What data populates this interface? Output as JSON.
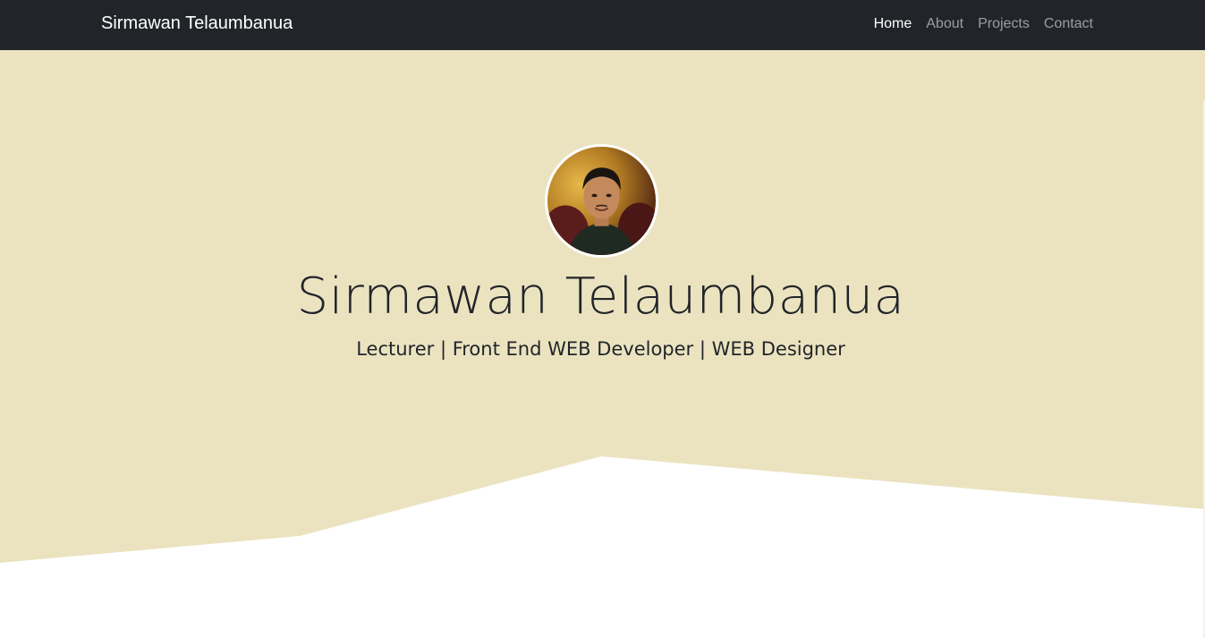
{
  "navbar": {
    "brand": "Sirmawan Telaumbanua",
    "links": [
      {
        "label": "Home",
        "active": true
      },
      {
        "label": "About",
        "active": false
      },
      {
        "label": "Projects",
        "active": false
      },
      {
        "label": "Contact",
        "active": false
      }
    ]
  },
  "hero": {
    "title": "Sirmawan Telaumbanua",
    "subtitle": "Lecturer | Front End WEB Developer | WEB Designer",
    "avatar_icon": "profile-photo",
    "background_color": "#ebe3c0",
    "wave_color": "#ffffff"
  },
  "colors": {
    "navbar_bg": "#212529",
    "text_dark": "#212529"
  }
}
